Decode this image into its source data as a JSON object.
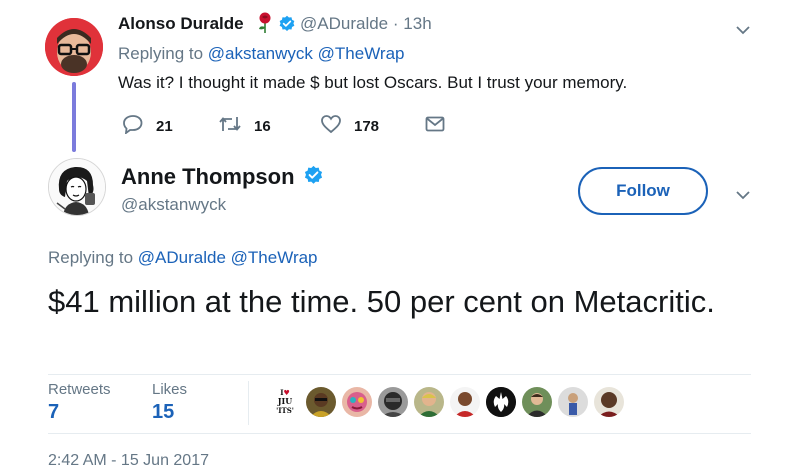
{
  "reply_tweet": {
    "author_name": "Alonso Duralde",
    "author_handle": "@ADuralde",
    "separator": "·",
    "time_ago": "13h",
    "replying_prefix": "Replying to",
    "replying_to": "@akstanwyck @TheWrap",
    "text": "Was it? I thought it made $ but lost Oscars. But I trust your memory.",
    "actions": {
      "reply_count": "21",
      "retweet_count": "16",
      "like_count": "178"
    }
  },
  "main_tweet": {
    "author_name": "Anne Thompson",
    "author_handle": "@akstanwyck",
    "follow_label": "Follow",
    "replying_prefix": "Replying to",
    "replying_to": "@ADuralde @TheWrap",
    "text": "$41 million at the time. 50 per cent on Metacritic.",
    "stats": {
      "retweets_label": "Retweets",
      "retweets_value": "7",
      "likes_label": "Likes",
      "likes_value": "15"
    },
    "likers": [
      {
        "name": "liker-jiujitsu",
        "text": "I♥ JIU 'ITS'"
      },
      {
        "name": "liker-2",
        "text": ""
      },
      {
        "name": "liker-3",
        "text": ""
      },
      {
        "name": "liker-4",
        "text": ""
      },
      {
        "name": "liker-5",
        "text": ""
      },
      {
        "name": "liker-rebel",
        "text": ""
      },
      {
        "name": "liker-7",
        "text": ""
      },
      {
        "name": "liker-8",
        "text": ""
      },
      {
        "name": "liker-9",
        "text": ""
      },
      {
        "name": "liker-10",
        "text": ""
      }
    ],
    "timestamp": "2:42 AM - 15 Jun 2017"
  },
  "colors": {
    "link": "#1b62b8",
    "muted": "#657786",
    "verified": "#1da1f2",
    "thread_line": "#7b7bdc",
    "avatar1_bg": "#e0323a"
  },
  "icons": [
    "rose-icon",
    "verified-icon",
    "chevron-down-icon",
    "reply-icon",
    "retweet-icon",
    "like-icon",
    "direct-message-icon"
  ]
}
